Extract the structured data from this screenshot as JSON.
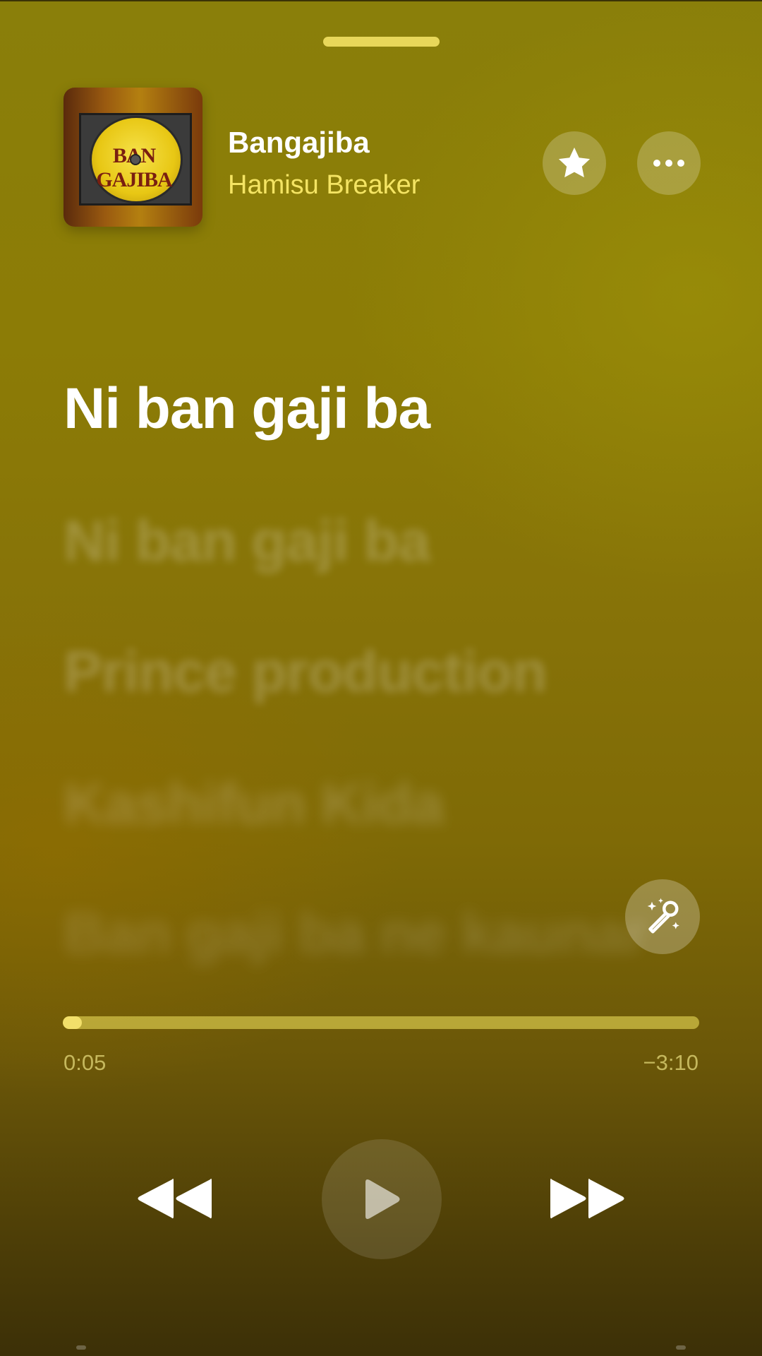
{
  "now_playing": {
    "title": "Bangajiba",
    "artist": "Hamisu Breaker",
    "artwork_text": "BAN GAJIBA"
  },
  "actions": {
    "favorite_icon": "star-icon",
    "more_icon": "ellipsis-icon"
  },
  "lyrics": {
    "current": "Ni ban gaji ba",
    "upcoming": [
      "Ni ban gaji ba",
      "Prince production",
      "Kashifun Kida",
      "Ban gaji ba ne kaunar"
    ]
  },
  "lyrics_mode_icon": "microphone-sparkles-icon",
  "playback": {
    "elapsed": "0:05",
    "remaining": "−3:10",
    "progress_fraction": 0.03,
    "state": "paused"
  },
  "colors": {
    "background": "#8a7f0a",
    "artist_text": "#f4e463",
    "progress_fill": "#f2df6a"
  }
}
